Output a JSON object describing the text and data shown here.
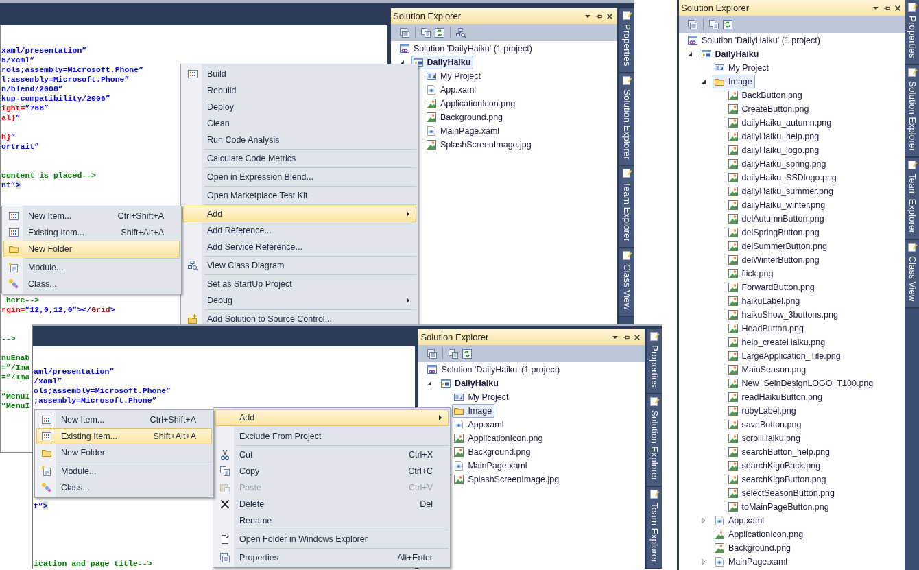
{
  "screenshots": [
    {
      "editor": {
        "blocks": [
          [
            [
              {
                "text": "xaml/presentation”",
                "color": "#0000ff"
              }
            ],
            [
              {
                "text": "6/xaml”",
                "color": "#0000ff"
              }
            ],
            [
              {
                "text": "rols;assembly=Microsoft.Phone”",
                "color": "#0000ff"
              }
            ],
            [
              {
                "text": "l;assembly=Microsoft.Phone”",
                "color": "#0000ff"
              }
            ],
            [
              {
                "text": "n/blend/2008”",
                "color": "#0000ff"
              }
            ],
            [
              {
                "text": "kup-compatibility/2006”",
                "color": "#0000ff"
              }
            ],
            [
              {
                "text": "ight=",
                "color": "#ff0000"
              },
              {
                "text": "”768”",
                "color": "#0000ff"
              }
            ],
            [
              {
                "text": "al}",
                "color": "#ff0000"
              },
              {
                "text": "”",
                "color": "#0000ff"
              }
            ]
          ],
          [
            [
              {
                "text": "h}",
                "color": "#ff0000"
              },
              {
                "text": "”",
                "color": "#0000ff"
              }
            ],
            [
              {
                "text": "ortrait”",
                "color": "#0000ff"
              }
            ]
          ],
          [
            [
              {
                "text": "content is placed-->",
                "color": "#008000"
              }
            ],
            [
              {
                "text": "nt”",
                "color": "#0000ff"
              },
              {
                "text": ">",
                "color": "#0000ff",
                "highlighted": true
              }
            ]
          ],
          [
            [
              {
                "text": " here-->",
                "color": "#008000"
              }
            ],
            [
              {
                "text": "rgin=",
                "color": "#ff0000"
              },
              {
                "text": "”12,0,12,0”></",
                "color": "#0000ff"
              },
              {
                "text": "Grid",
                "color": "#a31515"
              },
              {
                "text": ">",
                "color": "#0000ff"
              }
            ]
          ],
          [
            [
              {
                "text": "-->",
                "color": "#008000"
              }
            ]
          ],
          [
            [
              {
                "text": "nuEnab",
                "color": "#008000"
              }
            ],
            [
              {
                "text": "=”/Ima",
                "color": "#008000"
              }
            ],
            [
              {
                "text": "=”/Ima",
                "color": "#008000"
              }
            ]
          ],
          [
            [
              {
                "text": "”MenuI",
                "color": "#008000"
              }
            ],
            [
              {
                "text": "”MenuI",
                "color": "#008000"
              }
            ]
          ]
        ]
      },
      "solution_explorer": {
        "title": "Solution Explorer",
        "tree": [
          {
            "label": "Solution 'DailyHaiku' (1 project)",
            "kind": "solution",
            "selected": false,
            "children": [
              {
                "label": "DailyHaiku",
                "kind": "project",
                "selected": true,
                "expanded": true,
                "children": [
                  {
                    "label": "My Project",
                    "kind": "properties",
                    "selected": false
                  },
                  {
                    "label": "App.xaml",
                    "kind": "xaml",
                    "selected": false
                  },
                  {
                    "label": "ApplicationIcon.png",
                    "kind": "image",
                    "selected": false
                  },
                  {
                    "label": "Background.png",
                    "kind": "image",
                    "selected": false
                  },
                  {
                    "label": "MainPage.xaml",
                    "kind": "xaml",
                    "selected": false
                  },
                  {
                    "label": "SplashScreenImage.jpg",
                    "kind": "image",
                    "selected": false
                  }
                ]
              }
            ]
          }
        ]
      },
      "side_tabs": [
        {
          "label": "Properties"
        },
        {
          "label": "Solution Explorer"
        },
        {
          "label": "Team Explorer"
        },
        {
          "label": "Class View"
        }
      ],
      "context_menu": {
        "items": [
          {
            "label": "Build",
            "selected": false,
            "has_submenu": false
          },
          {
            "label": "Rebuild",
            "selected": false,
            "has_submenu": false
          },
          {
            "label": "Deploy",
            "selected": false,
            "has_submenu": false
          },
          {
            "label": "Clean",
            "selected": false,
            "has_submenu": false
          },
          {
            "label": "Run Code Analysis",
            "selected": false,
            "has_submenu": false
          },
          {
            "label": "Calculate Code Metrics",
            "selected": false,
            "has_submenu": false,
            "separator_before": true
          },
          {
            "label": "Open in Expression Blend...",
            "selected": false,
            "has_submenu": false,
            "separator_before": true
          },
          {
            "label": "Open Marketplace Test Kit",
            "selected": false,
            "has_submenu": false,
            "separator_before": true
          },
          {
            "label": "Add",
            "selected": true,
            "has_submenu": true,
            "separator_before": true
          },
          {
            "label": "Add Reference...",
            "selected": false,
            "has_submenu": false
          },
          {
            "label": "Add Service Reference...",
            "selected": false,
            "has_submenu": false
          },
          {
            "label": "View Class Diagram",
            "selected": false,
            "has_submenu": false,
            "separator_before": true
          },
          {
            "label": "Set as StartUp Project",
            "selected": false,
            "has_submenu": false,
            "separator_before": true
          },
          {
            "label": "Debug",
            "selected": false,
            "has_submenu": true
          },
          {
            "label": "Add Solution to Source Control...",
            "selected": false,
            "has_submenu": false,
            "separator_before": true
          }
        ]
      },
      "submenu": {
        "items": [
          {
            "label": "New Item...",
            "shortcut": "Ctrl+Shift+A",
            "selected": false
          },
          {
            "label": "Existing Item...",
            "shortcut": "Shift+Alt+A",
            "selected": false
          },
          {
            "label": "New Folder",
            "selected": true
          },
          {
            "label": "Module...",
            "selected": false,
            "separator_before": true
          },
          {
            "label": "Class...",
            "selected": false
          }
        ]
      }
    },
    {
      "editor": {
        "blocks": [
          [
            [
              {
                "text": "aml/presentation”",
                "color": "#0000ff"
              }
            ],
            [
              {
                "text": "/xaml”",
                "color": "#0000ff"
              }
            ],
            [
              {
                "text": "ols;assembly=Microsoft.Phone”",
                "color": "#0000ff"
              }
            ],
            [
              {
                "text": ";assembly=Microsoft.Phone”",
                "color": "#0000ff"
              }
            ]
          ],
          [
            [
              {
                "text": "t”",
                "color": "#0000ff"
              },
              {
                "text": ">",
                "color": "#0000ff",
                "highlighted": true
              }
            ]
          ],
          [
            [
              {
                "text": "ication and page title-->",
                "color": "#008000"
              }
            ]
          ]
        ]
      },
      "solution_explorer": {
        "title": "Solution Explorer",
        "tree": [
          {
            "label": "Solution 'DailyHaiku' (1 project)",
            "kind": "solution",
            "selected": false,
            "children": [
              {
                "label": "DailyHaiku",
                "kind": "project",
                "selected": false,
                "expanded": true,
                "children": [
                  {
                    "label": "My Project",
                    "kind": "properties",
                    "selected": false
                  },
                  {
                    "label": "Image",
                    "kind": "folder",
                    "selected": true
                  },
                  {
                    "label": "App.xaml",
                    "kind": "xaml",
                    "selected": false
                  },
                  {
                    "label": "ApplicationIcon.png",
                    "kind": "image",
                    "selected": false
                  },
                  {
                    "label": "Background.png",
                    "kind": "image",
                    "selected": false
                  },
                  {
                    "label": "MainPage.xaml",
                    "kind": "xaml",
                    "selected": false
                  },
                  {
                    "label": "SplashScreenImage.jpg",
                    "kind": "image",
                    "selected": false
                  }
                ]
              }
            ]
          }
        ]
      },
      "side_tabs": [
        {
          "label": "Properties"
        },
        {
          "label": "Solution Explorer"
        },
        {
          "label": "Team Explorer"
        }
      ],
      "context_menu": {
        "items": [
          {
            "label": "Add",
            "selected": true,
            "has_submenu": true,
            "disabled": false
          },
          {
            "label": "Exclude From Project",
            "selected": false,
            "has_submenu": false,
            "disabled": false,
            "separator_before": true
          },
          {
            "label": "Cut",
            "shortcut": "Ctrl+X",
            "selected": false,
            "has_submenu": false,
            "disabled": false,
            "separator_before": true
          },
          {
            "label": "Copy",
            "shortcut": "Ctrl+C",
            "selected": false,
            "has_submenu": false,
            "disabled": false
          },
          {
            "label": "Paste",
            "shortcut": "Ctrl+V",
            "selected": false,
            "has_submenu": false,
            "disabled": true
          },
          {
            "label": "Delete",
            "shortcut": "Del",
            "selected": false,
            "has_submenu": false,
            "disabled": false
          },
          {
            "label": "Rename",
            "selected": false,
            "has_submenu": false,
            "disabled": false
          },
          {
            "label": "Open Folder in Windows Explorer",
            "selected": false,
            "has_submenu": false,
            "disabled": false,
            "separator_before": true
          },
          {
            "label": "Properties",
            "shortcut": "Alt+Enter",
            "selected": false,
            "has_submenu": false,
            "disabled": false,
            "separator_before": true
          }
        ]
      },
      "submenu": {
        "items": [
          {
            "label": "New Item...",
            "shortcut": "Ctrl+Shift+A",
            "selected": false
          },
          {
            "label": "Existing Item...",
            "shortcut": "Shift+Alt+A",
            "selected": true
          },
          {
            "label": "New Folder",
            "selected": false
          },
          {
            "label": "Module...",
            "selected": false,
            "separator_before": true
          },
          {
            "label": "Class...",
            "selected": false
          }
        ]
      }
    },
    {
      "solution_explorer": {
        "title": "Solution Explorer",
        "tree": [
          {
            "label": "Solution 'DailyHaiku' (1 project)",
            "kind": "solution",
            "selected": false,
            "children": [
              {
                "label": "DailyHaiku",
                "kind": "project",
                "selected": false,
                "expanded": true,
                "children": [
                  {
                    "label": "My Project",
                    "kind": "properties",
                    "selected": false
                  },
                  {
                    "label": "Image",
                    "kind": "folder",
                    "selected": true,
                    "expanded": true,
                    "children": [
                      {
                        "label": "BackButton.png",
                        "kind": "image",
                        "selected": false
                      },
                      {
                        "label": "CreateButton.png",
                        "kind": "image",
                        "selected": false
                      },
                      {
                        "label": "dailyHaiku_autumn.png",
                        "kind": "image",
                        "selected": false
                      },
                      {
                        "label": "dailyHaiku_help.png",
                        "kind": "image",
                        "selected": false
                      },
                      {
                        "label": "dailyHaiku_logo.png",
                        "kind": "image",
                        "selected": false
                      },
                      {
                        "label": "dailyHaiku_spring.png",
                        "kind": "image",
                        "selected": false
                      },
                      {
                        "label": "dailyHaiku_SSDlogo.png",
                        "kind": "image",
                        "selected": false
                      },
                      {
                        "label": "dailyHaiku_summer.png",
                        "kind": "image",
                        "selected": false
                      },
                      {
                        "label": "dailyHaiku_winter.png",
                        "kind": "image",
                        "selected": false
                      },
                      {
                        "label": "delAutumnButton.png",
                        "kind": "image",
                        "selected": false
                      },
                      {
                        "label": "delSpringButton.png",
                        "kind": "image",
                        "selected": false
                      },
                      {
                        "label": "delSummerButton.png",
                        "kind": "image",
                        "selected": false
                      },
                      {
                        "label": "delWinterButton.png",
                        "kind": "image",
                        "selected": false
                      },
                      {
                        "label": "flick.png",
                        "kind": "image",
                        "selected": false
                      },
                      {
                        "label": "ForwardButton.png",
                        "kind": "image",
                        "selected": false
                      },
                      {
                        "label": "haikuLabel.png",
                        "kind": "image",
                        "selected": false
                      },
                      {
                        "label": "haikuShow_3buttons.png",
                        "kind": "image",
                        "selected": false
                      },
                      {
                        "label": "HeadButton.png",
                        "kind": "image",
                        "selected": false
                      },
                      {
                        "label": "help_createHaiku.png",
                        "kind": "image",
                        "selected": false
                      },
                      {
                        "label": "LargeApplication_Tile.png",
                        "kind": "image",
                        "selected": false
                      },
                      {
                        "label": "MainSeason.png",
                        "kind": "image",
                        "selected": false
                      },
                      {
                        "label": "New_SeinDesignLOGO_T100.png",
                        "kind": "image",
                        "selected": false
                      },
                      {
                        "label": "readHaikuButton.png",
                        "kind": "image",
                        "selected": false
                      },
                      {
                        "label": "rubyLabel.png",
                        "kind": "image",
                        "selected": false
                      },
                      {
                        "label": "saveButton.png",
                        "kind": "image",
                        "selected": false
                      },
                      {
                        "label": "scrollHaiku.png",
                        "kind": "image",
                        "selected": false
                      },
                      {
                        "label": "searchButton_help.png",
                        "kind": "image",
                        "selected": false
                      },
                      {
                        "label": "searchKigoBack.png",
                        "kind": "image",
                        "selected": false
                      },
                      {
                        "label": "searchKigoButton.png",
                        "kind": "image",
                        "selected": false
                      },
                      {
                        "label": "selectSeasonButton.png",
                        "kind": "image",
                        "selected": false
                      },
                      {
                        "label": "toMainPageButton.png",
                        "kind": "image",
                        "selected": false
                      }
                    ]
                  },
                  {
                    "label": "App.xaml",
                    "kind": "xaml",
                    "selected": false,
                    "expanded": false
                  },
                  {
                    "label": "ApplicationIcon.png",
                    "kind": "image",
                    "selected": false
                  },
                  {
                    "label": "Background.png",
                    "kind": "image",
                    "selected": false
                  },
                  {
                    "label": "MainPage.xaml",
                    "kind": "xaml",
                    "selected": false,
                    "expanded": false
                  }
                ]
              }
            ]
          }
        ]
      },
      "side_tabs": [
        {
          "label": "Properties"
        },
        {
          "label": "Solution Explorer"
        },
        {
          "label": "Team Explorer"
        },
        {
          "label": "Class View"
        }
      ]
    }
  ]
}
